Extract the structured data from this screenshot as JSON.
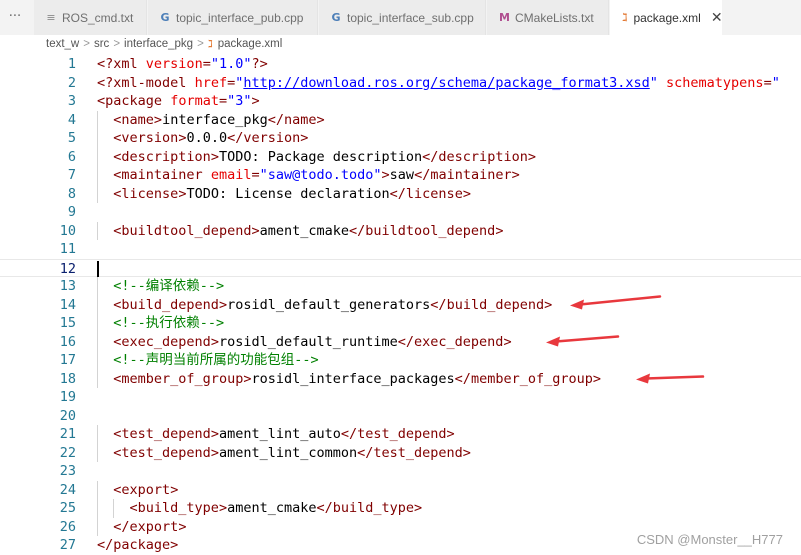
{
  "tabbar": {
    "more_label": "···",
    "tabs": [
      {
        "label": "ROS_cmd.txt",
        "icon": "≡"
      },
      {
        "label": "topic_interface_pub.cpp",
        "icon": "G"
      },
      {
        "label": "topic_interface_sub.cpp",
        "icon": "G"
      },
      {
        "label": "CMakeLists.txt",
        "icon": "M"
      },
      {
        "label": "package.xml",
        "icon": "ℷ",
        "close": "✕"
      }
    ]
  },
  "breadcrumb": {
    "parts": [
      "text_w",
      "src",
      "interface_pkg",
      "package.xml"
    ],
    "sep": ">",
    "file_icon": "ℷ"
  },
  "editor": {
    "active_line": 12,
    "lines": [
      {
        "n": "1",
        "tokens": [
          [
            "p",
            "<?"
          ],
          [
            "t",
            "xml"
          ],
          [
            "s",
            " "
          ],
          [
            "a",
            "version"
          ],
          [
            "p",
            "="
          ],
          [
            "v",
            "\"1.0\""
          ],
          [
            "p",
            "?>"
          ]
        ]
      },
      {
        "n": "2",
        "tokens": [
          [
            "p",
            "<?"
          ],
          [
            "t",
            "xml-model"
          ],
          [
            "s",
            " "
          ],
          [
            "a",
            "href"
          ],
          [
            "p",
            "="
          ],
          [
            "v",
            "\""
          ],
          [
            "l",
            "http://download.ros.org/schema/package_format3.xsd"
          ],
          [
            "v",
            "\""
          ],
          [
            "s",
            " "
          ],
          [
            "a",
            "schematypens"
          ],
          [
            "p",
            "="
          ],
          [
            "v",
            "\""
          ]
        ]
      },
      {
        "n": "3",
        "tokens": [
          [
            "p",
            "<"
          ],
          [
            "t",
            "package"
          ],
          [
            "s",
            " "
          ],
          [
            "a",
            "format"
          ],
          [
            "p",
            "="
          ],
          [
            "v",
            "\"3\""
          ],
          [
            "p",
            ">"
          ]
        ]
      },
      {
        "n": "4",
        "tokens": [
          [
            "s",
            "  "
          ],
          [
            "p",
            "<"
          ],
          [
            "t",
            "name"
          ],
          [
            "p",
            ">"
          ],
          [
            "s",
            "interface_pkg"
          ],
          [
            "p",
            "</"
          ],
          [
            "t",
            "name"
          ],
          [
            "p",
            ">"
          ]
        ]
      },
      {
        "n": "5",
        "tokens": [
          [
            "s",
            "  "
          ],
          [
            "p",
            "<"
          ],
          [
            "t",
            "version"
          ],
          [
            "p",
            ">"
          ],
          [
            "s",
            "0.0.0"
          ],
          [
            "p",
            "</"
          ],
          [
            "t",
            "version"
          ],
          [
            "p",
            ">"
          ]
        ]
      },
      {
        "n": "6",
        "tokens": [
          [
            "s",
            "  "
          ],
          [
            "p",
            "<"
          ],
          [
            "t",
            "description"
          ],
          [
            "p",
            ">"
          ],
          [
            "s",
            "TODO: Package description"
          ],
          [
            "p",
            "</"
          ],
          [
            "t",
            "description"
          ],
          [
            "p",
            ">"
          ]
        ]
      },
      {
        "n": "7",
        "tokens": [
          [
            "s",
            "  "
          ],
          [
            "p",
            "<"
          ],
          [
            "t",
            "maintainer"
          ],
          [
            "s",
            " "
          ],
          [
            "a",
            "email"
          ],
          [
            "p",
            "="
          ],
          [
            "v",
            "\"saw@todo.todo\""
          ],
          [
            "p",
            ">"
          ],
          [
            "s",
            "saw"
          ],
          [
            "p",
            "</"
          ],
          [
            "t",
            "maintainer"
          ],
          [
            "p",
            ">"
          ]
        ]
      },
      {
        "n": "8",
        "tokens": [
          [
            "s",
            "  "
          ],
          [
            "p",
            "<"
          ],
          [
            "t",
            "license"
          ],
          [
            "p",
            ">"
          ],
          [
            "s",
            "TODO: License declaration"
          ],
          [
            "p",
            "</"
          ],
          [
            "t",
            "license"
          ],
          [
            "p",
            ">"
          ]
        ]
      },
      {
        "n": "9",
        "tokens": []
      },
      {
        "n": "10",
        "tokens": [
          [
            "s",
            "  "
          ],
          [
            "p",
            "<"
          ],
          [
            "t",
            "buildtool_depend"
          ],
          [
            "p",
            ">"
          ],
          [
            "s",
            "ament_cmake"
          ],
          [
            "p",
            "</"
          ],
          [
            "t",
            "buildtool_depend"
          ],
          [
            "p",
            ">"
          ]
        ]
      },
      {
        "n": "11",
        "tokens": []
      },
      {
        "n": "12",
        "tokens": []
      },
      {
        "n": "13",
        "tokens": [
          [
            "s",
            "  "
          ],
          [
            "c",
            "<!--编译依赖-->"
          ]
        ]
      },
      {
        "n": "14",
        "tokens": [
          [
            "s",
            "  "
          ],
          [
            "p",
            "<"
          ],
          [
            "t",
            "build_depend"
          ],
          [
            "p",
            ">"
          ],
          [
            "s",
            "rosidl_default_generators"
          ],
          [
            "p",
            "</"
          ],
          [
            "t",
            "build_depend"
          ],
          [
            "p",
            ">"
          ]
        ]
      },
      {
        "n": "15",
        "tokens": [
          [
            "s",
            "  "
          ],
          [
            "c",
            "<!--执行依赖-->"
          ]
        ]
      },
      {
        "n": "16",
        "tokens": [
          [
            "s",
            "  "
          ],
          [
            "p",
            "<"
          ],
          [
            "t",
            "exec_depend"
          ],
          [
            "p",
            ">"
          ],
          [
            "s",
            "rosidl_default_runtime"
          ],
          [
            "p",
            "</"
          ],
          [
            "t",
            "exec_depend"
          ],
          [
            "p",
            ">"
          ]
        ]
      },
      {
        "n": "17",
        "tokens": [
          [
            "s",
            "  "
          ],
          [
            "c",
            "<!--声明当前所属的功能包组-->"
          ]
        ]
      },
      {
        "n": "18",
        "tokens": [
          [
            "s",
            "  "
          ],
          [
            "p",
            "<"
          ],
          [
            "t",
            "member_of_group"
          ],
          [
            "p",
            ">"
          ],
          [
            "s",
            "rosidl_interface_packages"
          ],
          [
            "p",
            "</"
          ],
          [
            "t",
            "member_of_group"
          ],
          [
            "p",
            ">"
          ]
        ]
      },
      {
        "n": "19",
        "tokens": []
      },
      {
        "n": "20",
        "tokens": []
      },
      {
        "n": "21",
        "tokens": [
          [
            "s",
            "  "
          ],
          [
            "p",
            "<"
          ],
          [
            "t",
            "test_depend"
          ],
          [
            "p",
            ">"
          ],
          [
            "s",
            "ament_lint_auto"
          ],
          [
            "p",
            "</"
          ],
          [
            "t",
            "test_depend"
          ],
          [
            "p",
            ">"
          ]
        ]
      },
      {
        "n": "22",
        "tokens": [
          [
            "s",
            "  "
          ],
          [
            "p",
            "<"
          ],
          [
            "t",
            "test_depend"
          ],
          [
            "p",
            ">"
          ],
          [
            "s",
            "ament_lint_common"
          ],
          [
            "p",
            "</"
          ],
          [
            "t",
            "test_depend"
          ],
          [
            "p",
            ">"
          ]
        ]
      },
      {
        "n": "23",
        "tokens": []
      },
      {
        "n": "24",
        "tokens": [
          [
            "s",
            "  "
          ],
          [
            "p",
            "<"
          ],
          [
            "t",
            "export"
          ],
          [
            "p",
            ">"
          ]
        ]
      },
      {
        "n": "25",
        "tokens": [
          [
            "s",
            "    "
          ],
          [
            "p",
            "<"
          ],
          [
            "t",
            "build_type"
          ],
          [
            "p",
            ">"
          ],
          [
            "s",
            "ament_cmake"
          ],
          [
            "p",
            "</"
          ],
          [
            "t",
            "build_type"
          ],
          [
            "p",
            ">"
          ]
        ]
      },
      {
        "n": "26",
        "tokens": [
          [
            "s",
            "  "
          ],
          [
            "p",
            "</"
          ],
          [
            "t",
            "export"
          ],
          [
            "p",
            ">"
          ]
        ]
      },
      {
        "n": "27",
        "tokens": [
          [
            "p",
            "</"
          ],
          [
            "t",
            "package"
          ],
          [
            "p",
            ">"
          ]
        ]
      }
    ]
  },
  "annotations": {
    "arrow_color": "#e8383d",
    "arrow_lines": [
      14,
      16,
      18
    ]
  },
  "watermark": "CSDN @Monster__H777",
  "colors": {
    "tag": "#800000",
    "attribute": "#e50000",
    "string": "#0000ff",
    "comment": "#008000",
    "line_number": "#237893"
  }
}
